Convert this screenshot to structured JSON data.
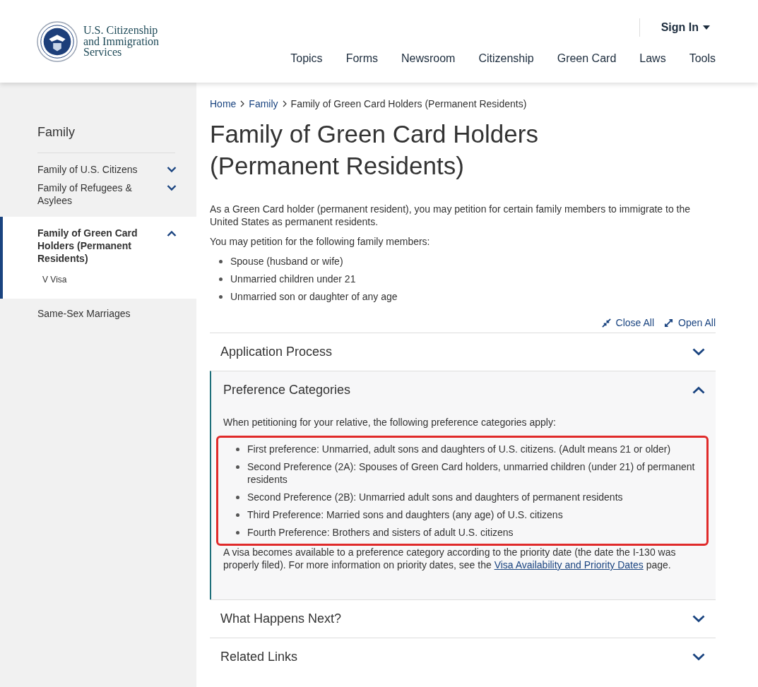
{
  "header": {
    "agency_lines": [
      "U.S. Citizenship",
      "and Immigration",
      "Services"
    ],
    "sign_in": "Sign In",
    "nav": [
      "Topics",
      "Forms",
      "Newsroom",
      "Citizenship",
      "Green Card",
      "Laws",
      "Tools"
    ]
  },
  "sidebar": {
    "title": "Family",
    "items": [
      {
        "label": "Family of U.S. Citizens",
        "kind": "toggle",
        "expanded": false,
        "selected": false
      },
      {
        "label": "Family of Refugees & Asylees",
        "kind": "toggle",
        "expanded": false,
        "selected": false
      },
      {
        "label": "Family of Green Card Holders (Permanent Residents)",
        "kind": "toggle",
        "expanded": true,
        "selected": true,
        "children": [
          {
            "label": "V Visa"
          }
        ]
      },
      {
        "label": "Same-Sex Marriages",
        "kind": "plain",
        "selected": false
      }
    ]
  },
  "breadcrumb": [
    {
      "label": "Home",
      "link": true
    },
    {
      "label": "Family",
      "link": true
    },
    {
      "label": "Family of Green Card Holders (Permanent Residents)",
      "link": false
    }
  ],
  "title": "Family of Green Card Holders (Permanent Residents)",
  "intro": "As a Green Card holder (permanent resident), you may petition for certain family members to immigrate to the United States as permanent residents.",
  "list_intro": "You may petition for the following family members:",
  "members": [
    "Spouse (husband or wife)",
    "Unmarried children under 21",
    "Unmarried son or daughter of any age"
  ],
  "accordion_tools": [
    "Close All",
    "Open All"
  ],
  "accordion": [
    {
      "title": "Application Process",
      "expanded": false
    },
    {
      "title": "Preference Categories",
      "expanded": true,
      "lead": "When petitioning for your relative, the following preference categories apply:",
      "highlighted": true,
      "categories": [
        "First preference: Unmarried, adult sons and daughters of U.S. citizens. (Adult means 21 or older)",
        "Second Preference (2A): Spouses of Green Card holders, unmarried children (under 21) of permanent residents",
        "Second Preference (2B): Unmarried adult sons and daughters of permanent residents",
        "Third Preference: Married sons and daughters (any age) of U.S. citizens",
        "Fourth Preference: Brothers and sisters of adult U.S. citizens"
      ],
      "note_before": "A visa becomes available to a preference category according to the priority date (the date the I-130 was properly filed). For more information on priority dates, see the",
      "note_link": "Visa Availability and Priority Dates",
      "note_after": "page."
    },
    {
      "title": "What Happens Next?",
      "expanded": false
    },
    {
      "title": "Related Links",
      "expanded": false
    }
  ]
}
